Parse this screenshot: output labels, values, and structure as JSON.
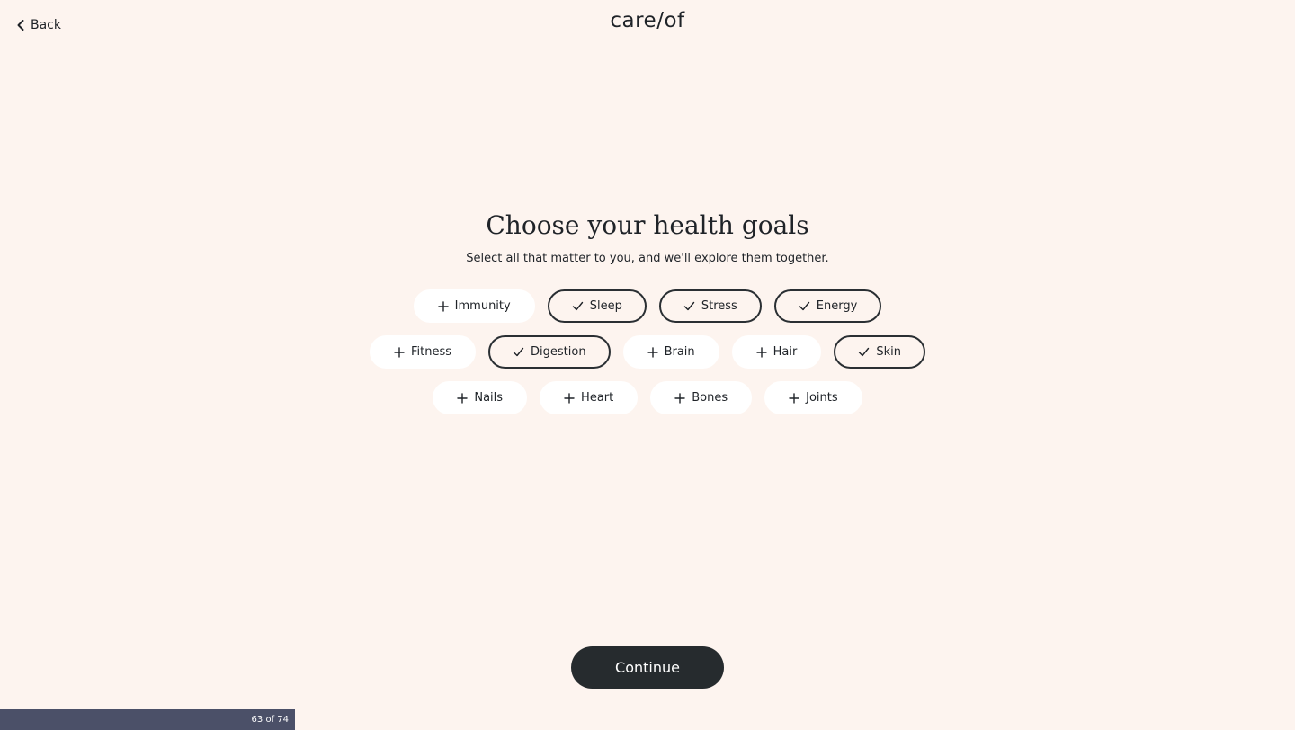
{
  "header": {
    "back_label": "Back",
    "logo_text": "care/of"
  },
  "main": {
    "title": "Choose your health goals",
    "subtitle": "Select all that matter to you, and we'll explore them together."
  },
  "goals": {
    "rows": [
      [
        {
          "label": "Immunity",
          "selected": false
        },
        {
          "label": "Sleep",
          "selected": true
        },
        {
          "label": "Stress",
          "selected": true
        },
        {
          "label": "Energy",
          "selected": true
        }
      ],
      [
        {
          "label": "Fitness",
          "selected": false
        },
        {
          "label": "Digestion",
          "selected": true
        },
        {
          "label": "Brain",
          "selected": false
        },
        {
          "label": "Hair",
          "selected": false
        },
        {
          "label": "Skin",
          "selected": true
        }
      ],
      [
        {
          "label": "Nails",
          "selected": false
        },
        {
          "label": "Heart",
          "selected": false
        },
        {
          "label": "Bones",
          "selected": false
        },
        {
          "label": "Joints",
          "selected": false
        }
      ]
    ],
    "icons": {
      "selected": "checkmark-icon",
      "unselected": "plus-icon"
    }
  },
  "footer": {
    "continue_label": "Continue",
    "progress_text": "63 of 74"
  },
  "colors": {
    "background": "#fdf4ef",
    "primary_dark": "#262b2e",
    "pill_unselected": "#ffffff",
    "progress_bar": "#4b5068"
  }
}
